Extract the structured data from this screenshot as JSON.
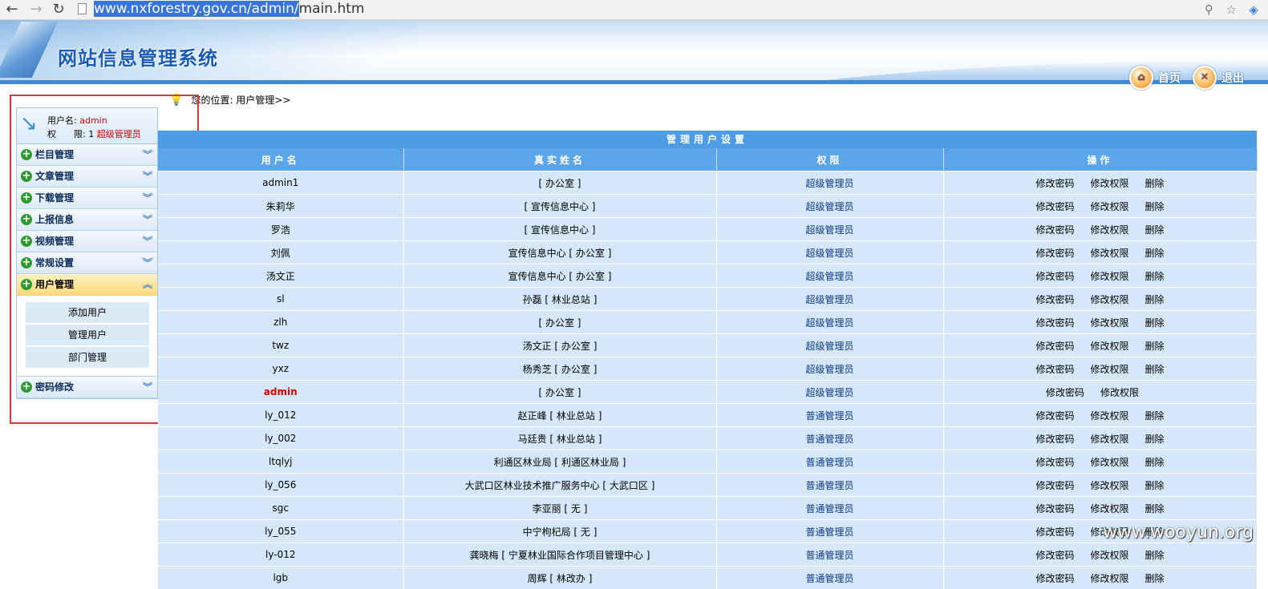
{
  "browser": {
    "url_selected": "www.nxforestry.gov.cn/admin/",
    "url_rest": "main.htm"
  },
  "header": {
    "title": "网站信息管理系统",
    "home_label": "首页",
    "logout_label": "退出"
  },
  "sidebar": {
    "user": {
      "name_label": "用户名:",
      "name_value": "admin",
      "role_label": "权　　限:",
      "role_level": "1",
      "role_value": "超级管理员"
    },
    "menu": [
      {
        "label": "栏目管理",
        "active": false
      },
      {
        "label": "文章管理",
        "active": false
      },
      {
        "label": "下载管理",
        "active": false
      },
      {
        "label": "上报信息",
        "active": false
      },
      {
        "label": "视频管理",
        "active": false
      },
      {
        "label": "常规设置",
        "active": false
      },
      {
        "label": "用户管理",
        "active": true
      }
    ],
    "submenu": [
      "添加用户",
      "管理用户",
      "部门管理"
    ],
    "menu_after": [
      {
        "label": "密码修改",
        "active": false
      }
    ]
  },
  "breadcrumb": "您的位置: 用户管理>>",
  "table": {
    "caption": "管理用户设置",
    "headers": [
      "用户名",
      "真实姓名",
      "权限",
      "操作"
    ],
    "op_labels": {
      "change_pwd": "修改密码",
      "change_priv": "修改权限",
      "delete": "删除"
    },
    "rows": [
      {
        "user": "admin1",
        "realname": "[ 办公室 ]",
        "priv": "超级管理员",
        "delete": true
      },
      {
        "user": "朱莉华",
        "realname": "[ 宣传信息中心 ]",
        "priv": "超级管理员",
        "delete": true
      },
      {
        "user": "罗浩",
        "realname": "[ 宣传信息中心 ]",
        "priv": "超级管理员",
        "delete": true
      },
      {
        "user": "刘佩",
        "realname": "宣传信息中心 [ 办公室 ]",
        "priv": "超级管理员",
        "delete": true
      },
      {
        "user": "汤文正",
        "realname": "宣传信息中心 [ 办公室 ]",
        "priv": "超级管理员",
        "delete": true
      },
      {
        "user": "sl",
        "realname": "孙磊 [ 林业总站 ]",
        "priv": "超级管理员",
        "delete": true
      },
      {
        "user": "zlh",
        "realname": "[ 办公室 ]",
        "priv": "超级管理员",
        "delete": true
      },
      {
        "user": "twz",
        "realname": "汤文正 [ 办公室 ]",
        "priv": "超级管理员",
        "delete": true
      },
      {
        "user": "yxz",
        "realname": "杨秀芝 [ 办公室 ]",
        "priv": "超级管理员",
        "delete": true
      },
      {
        "user": "admin",
        "realname": "[ 办公室 ]",
        "priv": "超级管理员",
        "delete": false,
        "highlight": true
      },
      {
        "user": "ly_012",
        "realname": "赵正峰 [ 林业总站 ]",
        "priv": "普通管理员",
        "delete": true
      },
      {
        "user": "ly_002",
        "realname": "马廷贵 [ 林业总站 ]",
        "priv": "普通管理员",
        "delete": true
      },
      {
        "user": "ltqlyj",
        "realname": "利通区林业局 [ 利通区林业局 ]",
        "priv": "普通管理员",
        "delete": true
      },
      {
        "user": "ly_056",
        "realname": "大武口区林业技术推广服务中心 [ 大武口区 ]",
        "priv": "普通管理员",
        "delete": true
      },
      {
        "user": "sgc",
        "realname": "李亚丽 [ 无 ]",
        "priv": "普通管理员",
        "delete": true
      },
      {
        "user": "ly_055",
        "realname": "中宁枸杞局 [ 无 ]",
        "priv": "普通管理员",
        "delete": true
      },
      {
        "user": "ly-012",
        "realname": "龚晓梅 [ 宁夏林业国际合作项目管理中心 ]",
        "priv": "普通管理员",
        "delete": true
      },
      {
        "user": "lgb",
        "realname": "周辉 [ 林改办 ]",
        "priv": "普通管理员",
        "delete": true
      }
    ]
  },
  "watermark": "www.wooyun.org",
  "colors": {
    "header_blue": "#3e8ad8",
    "table_header": "#5ba6ea",
    "row_bg": "#d5e7f8",
    "highlight_red": "#d43b3b"
  }
}
